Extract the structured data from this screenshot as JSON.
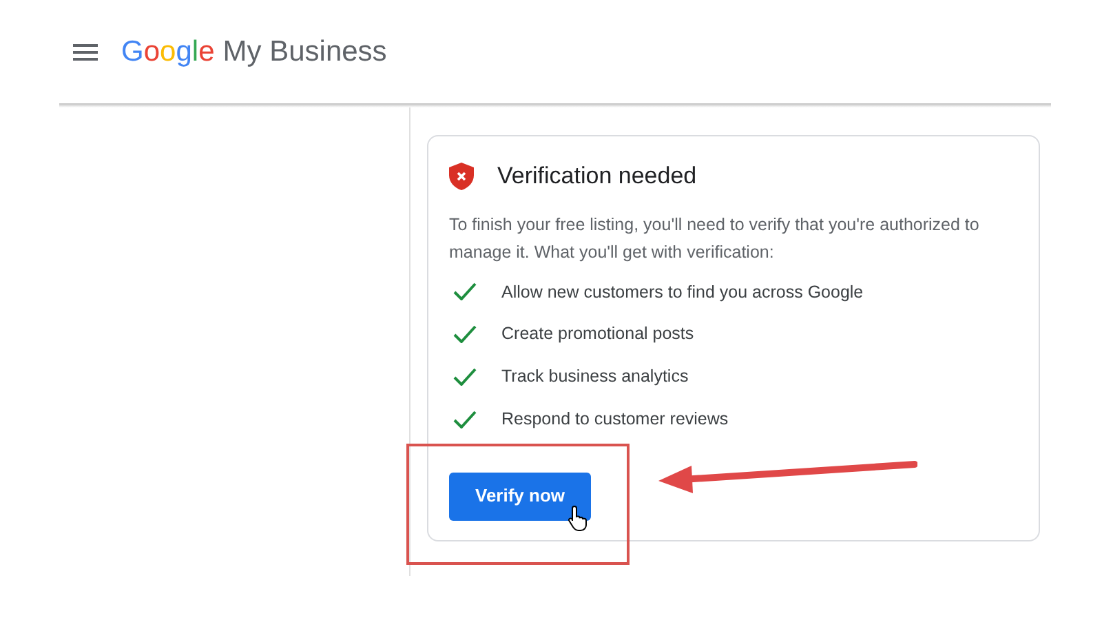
{
  "header": {
    "logo": "Google",
    "product": "My Business"
  },
  "card": {
    "title": "Verification needed",
    "description": "To finish your free listing, you'll need to verify that you're authorized to manage it. What you'll get with verification:",
    "benefits": [
      "Allow new customers to find you across Google",
      "Create promotional posts",
      "Track business analytics",
      "Respond to customer reviews"
    ],
    "button": "Verify now"
  }
}
